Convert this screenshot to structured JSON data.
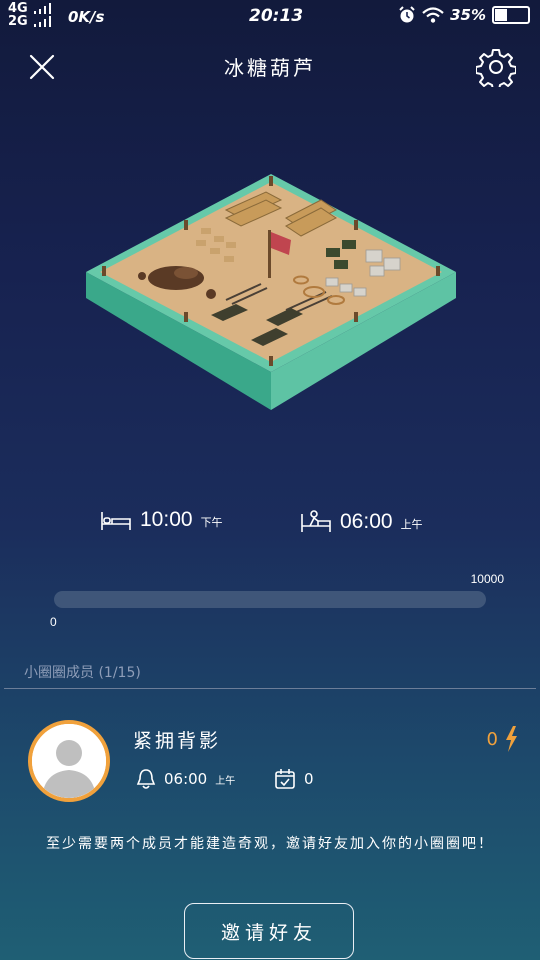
{
  "status_bar": {
    "network_top": "4G",
    "network_bottom": "2G",
    "speed": "0K/s",
    "time": "20:13",
    "battery": "35%"
  },
  "header": {
    "title": "冰糖葫芦",
    "close_icon": "close-icon",
    "settings_icon": "gear-icon"
  },
  "alarms": {
    "sleep_time": "10:00",
    "sleep_period": "下午",
    "wake_time": "06:00",
    "wake_period": "上午"
  },
  "progress": {
    "min_label": "0",
    "max_label": "10000",
    "value": 0,
    "max": 10000
  },
  "members": {
    "label": "小圈圈成员",
    "count": "(1/15)",
    "items": [
      {
        "name": "紧拥背影",
        "energy": "0",
        "alarm_time": "06:00",
        "alarm_period": "上午",
        "checkins": "0"
      }
    ]
  },
  "notice": "至少需要两个成员才能建造奇观，邀请好友加入你的小圈圈吧！",
  "invite_button": "邀请好友",
  "colors": {
    "accent": "#f0a13c",
    "track": "#3f5679",
    "platform_top": "#d9b384",
    "platform_side": "#46b495"
  }
}
